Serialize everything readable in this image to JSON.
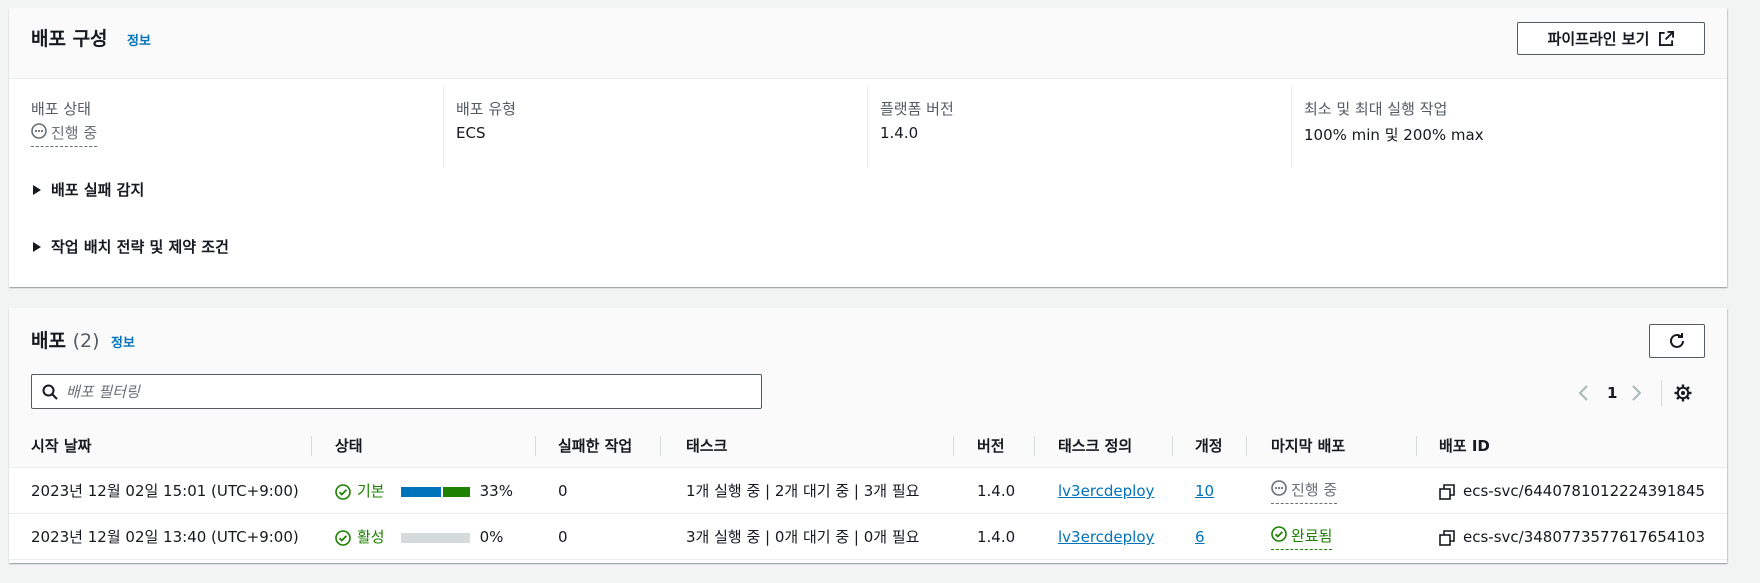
{
  "config": {
    "title": "배포 구성",
    "info": "정보",
    "pipeline_button": "파이프라인 보기",
    "fields": [
      {
        "label": "배포 상태",
        "value": "진행 중"
      },
      {
        "label": "배포 유형",
        "value": "ECS"
      },
      {
        "label": "플랫폼 버전",
        "value": "1.4.0"
      },
      {
        "label": "최소 및 최대 실행 작업",
        "value": "100% min 및 200% max"
      }
    ],
    "expanders": [
      "배포 실패 감지",
      "작업 배치 전략 및 제약 조건"
    ]
  },
  "deployments": {
    "title": "배포",
    "count": "(2)",
    "info": "정보",
    "search_placeholder": "배포 필터링",
    "page": "1",
    "columns": [
      "시작 날짜",
      "상태",
      "실패한 작업",
      "태스크",
      "버전",
      "태스크 정의",
      "개정",
      "마지막 배포",
      "배포 ID"
    ],
    "rows": [
      {
        "start": "2023년 12월 02일 15:01 (UTC+9:00)",
        "status": "기본",
        "progress": 0.33,
        "progress_label": "33%",
        "failed": "0",
        "tasks": "1개 실행 중 | 2개 대기 중 | 3개 필요",
        "version": "1.4.0",
        "taskdef": "lv3ercdeploy",
        "revision": "10",
        "last": "진행 중",
        "id": "ecs-svc/6440781012224391845"
      },
      {
        "start": "2023년 12월 02일 13:40 (UTC+9:00)",
        "status": "활성",
        "progress": 0,
        "progress_label": "0%",
        "failed": "0",
        "tasks": "3개 실행 중 | 0개 대기 중 | 0개 필요",
        "version": "1.4.0",
        "taskdef": "lv3ercdeploy",
        "revision": "6",
        "last": "완료됨",
        "id": "ecs-svc/3480773577617654103"
      }
    ]
  },
  "colors": {
    "link": "#0073bb",
    "success": "#1d8102",
    "bar_blue": "#0073bb",
    "bar_green": "#1d8102",
    "bar_track": "#d5dbdb"
  }
}
